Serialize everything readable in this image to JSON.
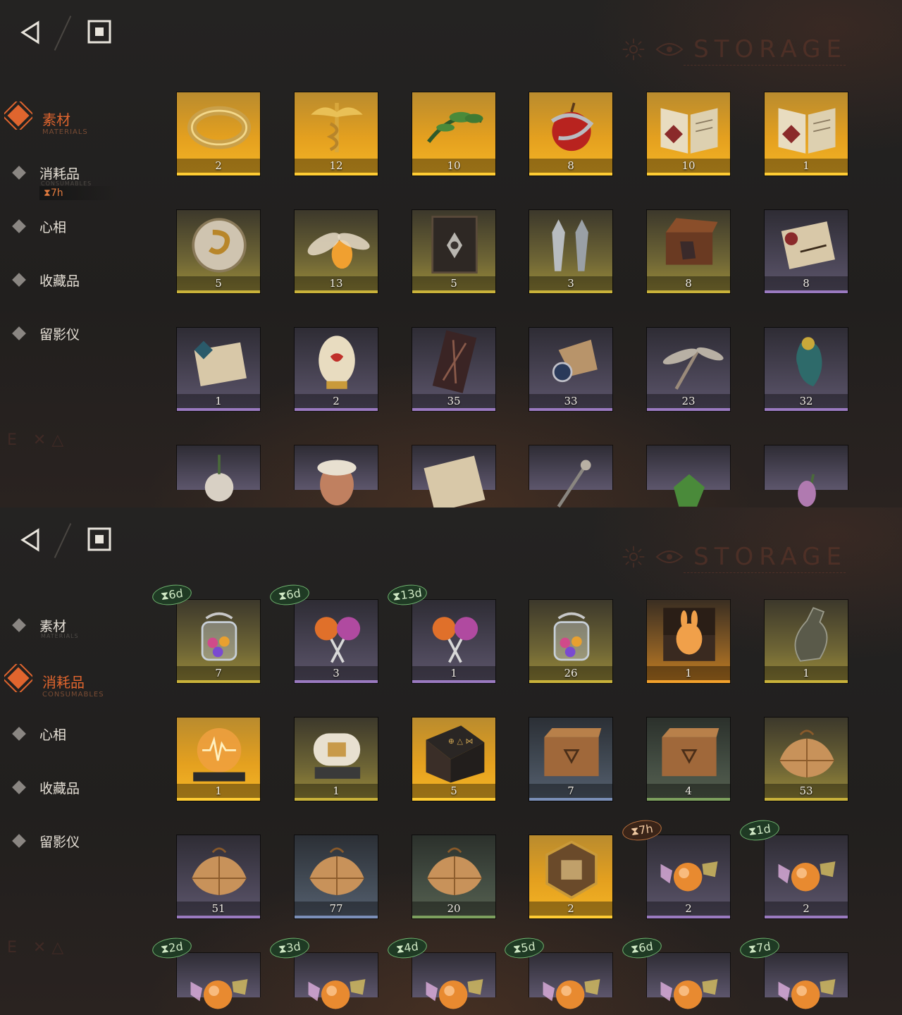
{
  "colors": {
    "accent": "#e0652e",
    "timer_green": "#6fb46f",
    "timer_orange": "#b8703e"
  },
  "panels": [
    {
      "brand": "STORAGE",
      "sidebar": [
        {
          "label": "素材",
          "sub": "MATERIALS",
          "active": true
        },
        {
          "label": "消耗品",
          "sub": "CONSUMABLES",
          "active": false
        },
        {
          "label": "心相",
          "sub": "",
          "active": false
        },
        {
          "label": "收藏品",
          "sub": "",
          "active": false
        },
        {
          "label": "留影仪",
          "sub": "",
          "active": false
        }
      ],
      "sidebar_timer": "⧗7h",
      "deco": "E ✕△",
      "items": [
        {
          "count": "2",
          "icon": "ring-icon",
          "rarity": "gold"
        },
        {
          "count": "12",
          "icon": "caduceus-icon",
          "rarity": "gold"
        },
        {
          "count": "10",
          "icon": "laurel-icon",
          "rarity": "gold"
        },
        {
          "count": "8",
          "icon": "apple-serpent-icon",
          "rarity": "gold"
        },
        {
          "count": "10",
          "icon": "open-book-icon",
          "rarity": "gold"
        },
        {
          "count": "1",
          "icon": "open-book-icon",
          "rarity": "gold"
        },
        {
          "count": "5",
          "icon": "brass-sphere-icon",
          "rarity": "yellow"
        },
        {
          "count": "13",
          "icon": "firefly-icon",
          "rarity": "yellow"
        },
        {
          "count": "5",
          "icon": "tome-icon",
          "rarity": "yellow"
        },
        {
          "count": "3",
          "icon": "bullets-icon",
          "rarity": "yellow"
        },
        {
          "count": "8",
          "icon": "chest-glove-icon",
          "rarity": "yellow"
        },
        {
          "count": "8",
          "icon": "scroll-icon",
          "rarity": "purple"
        },
        {
          "count": "1",
          "icon": "scroll-seal-icon",
          "rarity": "purple"
        },
        {
          "count": "2",
          "icon": "jeweled-egg-icon",
          "rarity": "purple"
        },
        {
          "count": "35",
          "icon": "case-icon",
          "rarity": "purple"
        },
        {
          "count": "33",
          "icon": "mechanism-icon",
          "rarity": "purple"
        },
        {
          "count": "23",
          "icon": "winged-key-icon",
          "rarity": "purple"
        },
        {
          "count": "32",
          "icon": "bird-icon",
          "rarity": "purple"
        },
        {
          "count": "",
          "icon": "plant-icon",
          "rarity": "purple"
        },
        {
          "count": "",
          "icon": "mask-icon",
          "rarity": "purple"
        },
        {
          "count": "",
          "icon": "parchment-icon",
          "rarity": "purple"
        },
        {
          "count": "",
          "icon": "wand-icon",
          "rarity": "purple"
        },
        {
          "count": "",
          "icon": "gem-icon",
          "rarity": "purple"
        },
        {
          "count": "",
          "icon": "flower-icon",
          "rarity": "purple"
        }
      ]
    },
    {
      "brand": "STORAGE",
      "sidebar": [
        {
          "label": "素材",
          "sub": "MATERIALS",
          "active": false
        },
        {
          "label": "消耗品",
          "sub": "CONSUMABLES",
          "active": true
        },
        {
          "label": "心相",
          "sub": "",
          "active": false
        },
        {
          "label": "收藏品",
          "sub": "",
          "active": false
        },
        {
          "label": "留影仪",
          "sub": "",
          "active": false
        }
      ],
      "deco": "E ✕△",
      "items": [
        {
          "count": "7",
          "icon": "candy-jar-icon",
          "rarity": "yellow",
          "timer": "⧗6d",
          "timer_color": "green"
        },
        {
          "count": "3",
          "icon": "lollipops-icon",
          "rarity": "purple",
          "timer": "⧗6d",
          "timer_color": "green"
        },
        {
          "count": "1",
          "icon": "lollipops-icon",
          "rarity": "purple",
          "timer": "⧗13d",
          "timer_color": "green"
        },
        {
          "count": "26",
          "icon": "candy-jar-icon",
          "rarity": "yellow"
        },
        {
          "count": "1",
          "icon": "rabbit-box-icon",
          "rarity": "brown"
        },
        {
          "count": "1",
          "icon": "bottle-icon",
          "rarity": "yellow"
        },
        {
          "count": "1",
          "icon": "radio-sphere-icon",
          "rarity": "gold"
        },
        {
          "count": "1",
          "icon": "capsule-machine-icon",
          "rarity": "yellow"
        },
        {
          "count": "5",
          "icon": "rune-table-icon",
          "rarity": "gold"
        },
        {
          "count": "7",
          "icon": "crate-icon",
          "rarity": "blue"
        },
        {
          "count": "4",
          "icon": "crate-icon",
          "rarity": "green"
        },
        {
          "count": "53",
          "icon": "parcel-icon",
          "rarity": "yellow"
        },
        {
          "count": "51",
          "icon": "parcel-icon",
          "rarity": "purple"
        },
        {
          "count": "77",
          "icon": "parcel-icon",
          "rarity": "blue"
        },
        {
          "count": "20",
          "icon": "parcel-icon",
          "rarity": "green"
        },
        {
          "count": "2",
          "icon": "puzzle-hexagon-icon",
          "rarity": "gold"
        },
        {
          "count": "2",
          "icon": "candies-icon",
          "rarity": "purple",
          "timer": "⧗7h",
          "timer_color": "orange"
        },
        {
          "count": "2",
          "icon": "candies-icon",
          "rarity": "purple",
          "timer": "⧗1d",
          "timer_color": "green"
        },
        {
          "count": "",
          "icon": "candies-icon",
          "rarity": "purple",
          "timer": "⧗2d",
          "timer_color": "green"
        },
        {
          "count": "",
          "icon": "candies-icon",
          "rarity": "purple",
          "timer": "⧗3d",
          "timer_color": "green"
        },
        {
          "count": "",
          "icon": "candies-icon",
          "rarity": "purple",
          "timer": "⧗4d",
          "timer_color": "green"
        },
        {
          "count": "",
          "icon": "candies-icon",
          "rarity": "purple",
          "timer": "⧗5d",
          "timer_color": "green"
        },
        {
          "count": "",
          "icon": "candies-icon",
          "rarity": "purple",
          "timer": "⧗6d",
          "timer_color": "green"
        },
        {
          "count": "",
          "icon": "candies-icon",
          "rarity": "purple",
          "timer": "⧗7d",
          "timer_color": "green"
        }
      ]
    }
  ]
}
